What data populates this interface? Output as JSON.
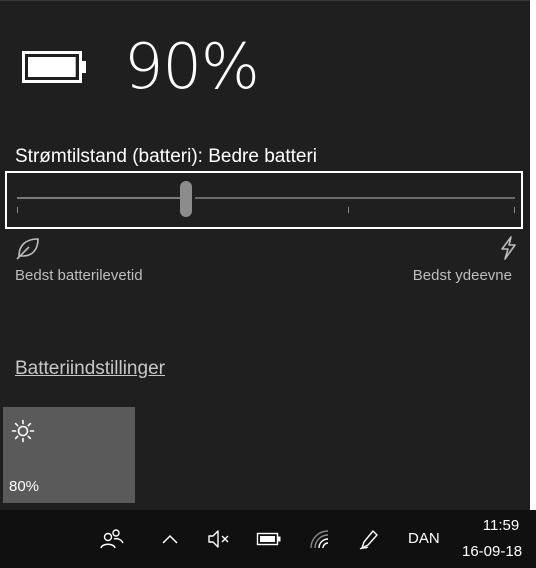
{
  "battery": {
    "percent_label": "90%",
    "charge_fraction": 0.9
  },
  "power_mode": {
    "label": "Strømtilstand (batteri): Bedre batteri",
    "slider_position": 1,
    "slider_positions_total": 4,
    "min_label": "Bedst batterilevetid",
    "max_label": "Bedst ydeevne",
    "min_icon": "leaf-icon",
    "max_icon": "lightning-icon"
  },
  "settings_link": "Batteriindstillinger",
  "brightness_tile": {
    "icon": "sun-icon",
    "value": "80%"
  },
  "taskbar": {
    "icons": [
      "people-icon",
      "chevron-up-icon",
      "speaker-muted-icon",
      "battery-icon",
      "wifi-icon",
      "pen-icon"
    ],
    "language": "DAN",
    "time": "11:59",
    "date": "16-09-18"
  },
  "colors": {
    "flyout_bg": "#1f1f1f",
    "taskbar_bg": "#101010",
    "tile_bg": "#5a5a5a",
    "text": "#ffffff",
    "subtext": "#bdbdbd"
  }
}
